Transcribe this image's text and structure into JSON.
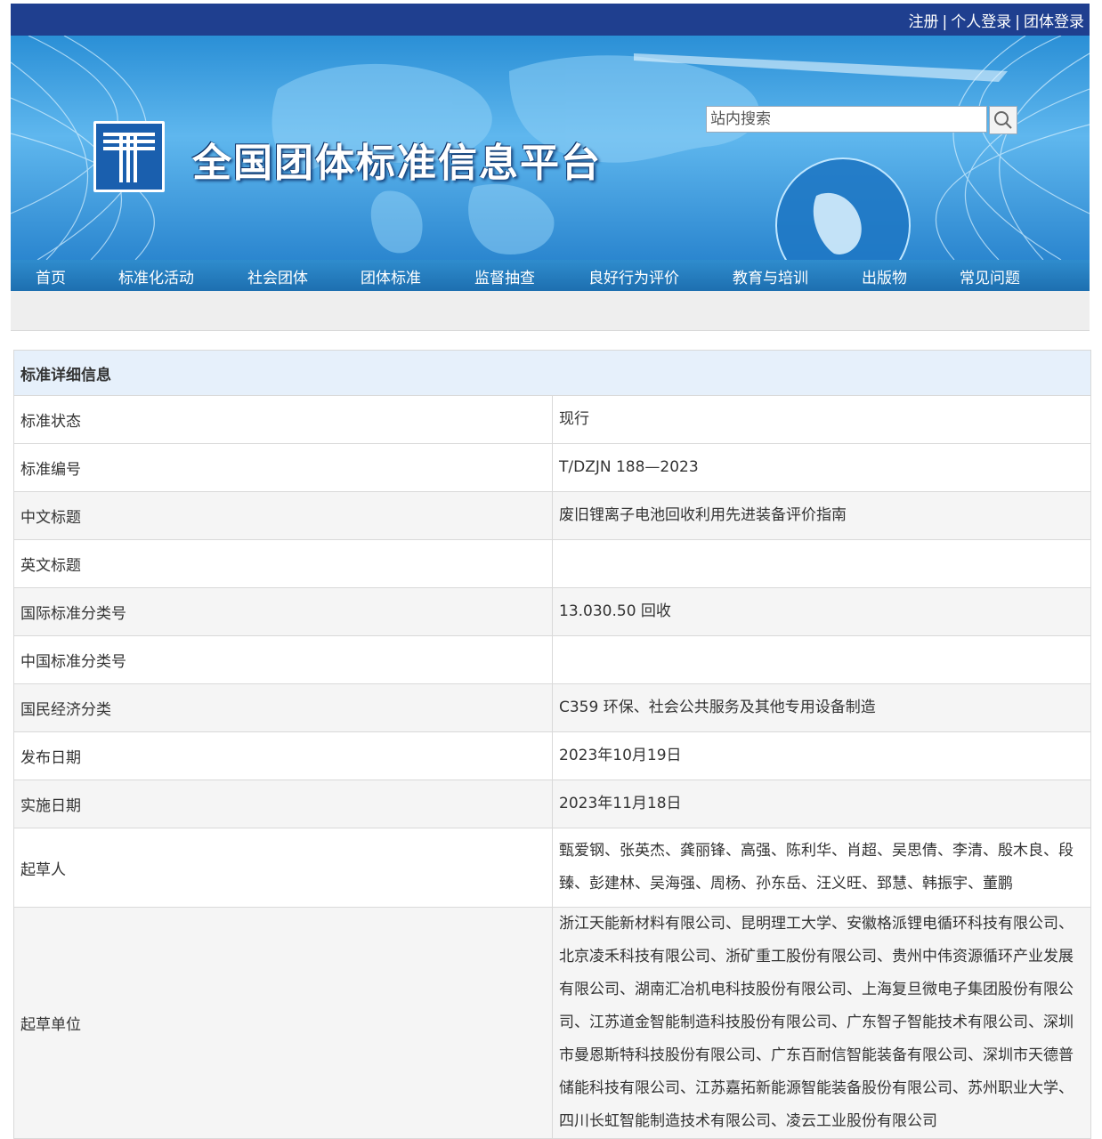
{
  "top_links": {
    "register": "注册",
    "separator": "|",
    "personal_login": "个人登录",
    "group_login": "团体登录"
  },
  "site": {
    "title": "全国团体标准信息平台"
  },
  "search": {
    "placeholder": "站内搜索"
  },
  "nav": [
    {
      "label": "首页"
    },
    {
      "label": "标准化活动"
    },
    {
      "label": "社会团体"
    },
    {
      "label": "团体标准"
    },
    {
      "label": "监督抽查"
    },
    {
      "label": "良好行为评价"
    },
    {
      "label": "教育与培训"
    },
    {
      "label": "出版物"
    },
    {
      "label": "常见问题"
    }
  ],
  "detail": {
    "heading": "标准详细信息",
    "rows": [
      {
        "key": "标准状态",
        "value": "现行"
      },
      {
        "key": "标准编号",
        "value": "T/DZJN 188—2023"
      },
      {
        "key": "中文标题",
        "value": "废旧锂离子电池回收利用先进装备评价指南"
      },
      {
        "key": "英文标题",
        "value": ""
      },
      {
        "key": "国际标准分类号",
        "value": "13.030.50 回收"
      },
      {
        "key": "中国标准分类号",
        "value": ""
      },
      {
        "key": "国民经济分类",
        "value": "C359 环保、社会公共服务及其他专用设备制造"
      },
      {
        "key": "发布日期",
        "value": "2023年10月19日"
      },
      {
        "key": "实施日期",
        "value": "2023年11月18日"
      },
      {
        "key": "起草人",
        "value": "甄爱钢、张英杰、龚丽锋、高强、陈利华、肖超、吴思倩、李清、殷木良、段臻、彭建林、吴海强、周杨、孙东岳、汪义旺、郅慧、韩振宇、董鹏"
      },
      {
        "key": "起草单位",
        "value": "浙江天能新材料有限公司、昆明理工大学、安徽格派锂电循环科技有限公司、北京凌禾科技有限公司、浙矿重工股份有限公司、贵州中伟资源循环产业发展有限公司、湖南汇冶机电科技股份有限公司、上海复旦微电子集团股份有限公司、江苏道金智能制造科技股份有限公司、广东智子智能技术有限公司、深圳市曼恩斯特科技股份有限公司、广东百耐信智能装备有限公司、深圳市天德普储能科技有限公司、江苏嘉拓新能源智能装备股份有限公司、苏州职业大学、四川长虹智能制造技术有限公司、凌云工业股份有限公司"
      }
    ]
  }
}
